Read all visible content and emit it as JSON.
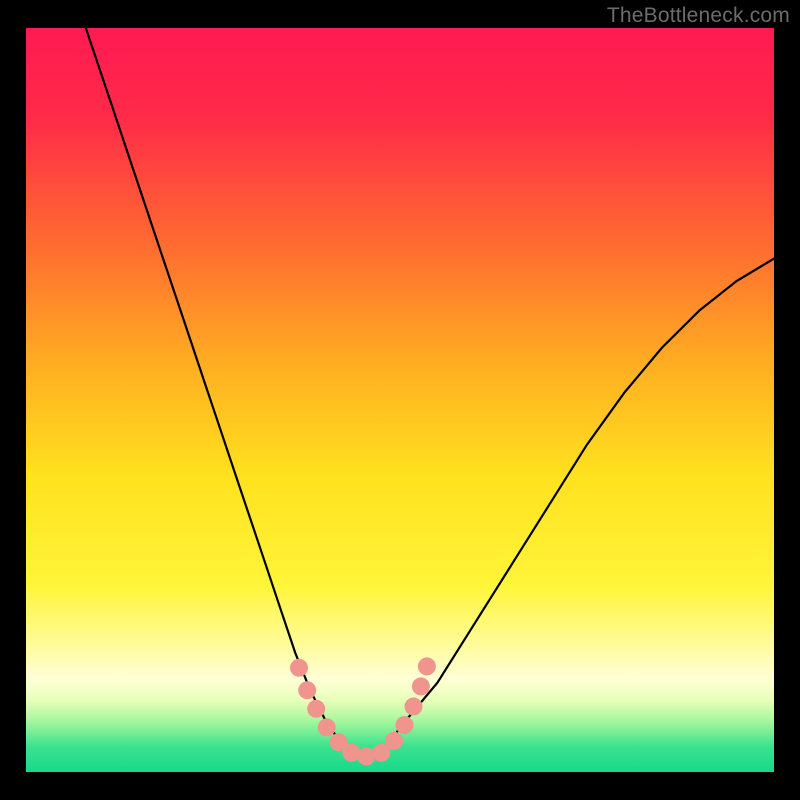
{
  "watermark": "TheBottleneck.com",
  "chart_data": {
    "type": "line",
    "title": "",
    "xlabel": "",
    "ylabel": "",
    "xlim": [
      0,
      100
    ],
    "ylim": [
      0,
      100
    ],
    "background": {
      "type": "vertical-gradient",
      "stops": [
        {
          "offset": 0.0,
          "color": "#ff1a53"
        },
        {
          "offset": 0.12,
          "color": "#ff2a48"
        },
        {
          "offset": 0.3,
          "color": "#ff6f2f"
        },
        {
          "offset": 0.45,
          "color": "#ffad22"
        },
        {
          "offset": 0.6,
          "color": "#ffe11e"
        },
        {
          "offset": 0.75,
          "color": "#fff53a"
        },
        {
          "offset": 0.82,
          "color": "#fffb8f"
        },
        {
          "offset": 0.875,
          "color": "#ffffd6"
        },
        {
          "offset": 0.905,
          "color": "#e6ffb8"
        },
        {
          "offset": 0.935,
          "color": "#9cf59a"
        },
        {
          "offset": 0.965,
          "color": "#3de28f"
        },
        {
          "offset": 1.0,
          "color": "#16d98a"
        }
      ]
    },
    "series": [
      {
        "name": "bottleneck-curve",
        "color": "#000000",
        "x": [
          8,
          10,
          12,
          14,
          16,
          18,
          20,
          22,
          24,
          26,
          28,
          30,
          32,
          34,
          36,
          38,
          40,
          42,
          44,
          46,
          48,
          50,
          55,
          60,
          65,
          70,
          75,
          80,
          85,
          90,
          95,
          100
        ],
        "y": [
          100,
          94,
          88,
          82,
          76,
          70,
          64,
          58,
          52,
          46,
          40,
          34,
          28,
          22,
          16,
          11,
          7,
          4,
          2,
          1.5,
          3,
          6,
          12,
          20,
          28,
          36,
          44,
          51,
          57,
          62,
          66,
          69
        ]
      }
    ],
    "highlight": {
      "name": "optimal-range-marker",
      "color": "#f0948e",
      "points_xy": [
        [
          36.5,
          14
        ],
        [
          37.6,
          11
        ],
        [
          38.8,
          8.5
        ],
        [
          40.2,
          6
        ],
        [
          41.8,
          4
        ],
        [
          43.5,
          2.6
        ],
        [
          45.5,
          2.1
        ],
        [
          47.5,
          2.6
        ],
        [
          49.2,
          4.2
        ],
        [
          50.6,
          6.3
        ],
        [
          51.8,
          8.8
        ],
        [
          52.8,
          11.5
        ],
        [
          53.6,
          14.2
        ]
      ]
    }
  }
}
